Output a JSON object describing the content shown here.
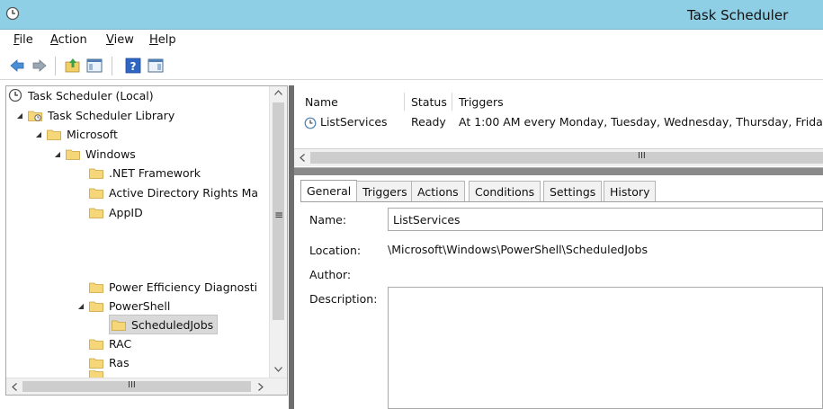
{
  "window": {
    "title": "Task Scheduler"
  },
  "menubar": {
    "items": [
      "File",
      "Action",
      "View",
      "Help"
    ]
  },
  "toolbar": {
    "buttons": [
      "back-arrow-icon",
      "forward-arrow-icon",
      "folder-up-icon",
      "console-tree-icon",
      "help-icon",
      "action-pane-icon"
    ]
  },
  "tree": {
    "items": [
      {
        "label": "Task Scheduler (Local)",
        "icon": "clock-icon"
      },
      {
        "label": "Task Scheduler Library",
        "icon": "library-folder-icon",
        "arrow": "◢"
      },
      {
        "label": "Microsoft",
        "icon": "folder-icon",
        "arrow": "◢"
      },
      {
        "label": "Windows",
        "icon": "folder-icon",
        "arrow": "◢"
      },
      {
        "label": ".NET Framework",
        "icon": "folder-icon"
      },
      {
        "label": "Active Directory Rights Ma",
        "icon": "folder-icon"
      },
      {
        "label": "AppID",
        "icon": "folder-icon"
      },
      {
        "label": "Power Efficiency Diagnosti",
        "icon": "folder-icon"
      },
      {
        "label": "PowerShell",
        "icon": "folder-icon",
        "arrow": "◢"
      },
      {
        "label": "ScheduledJobs",
        "icon": "folder-icon",
        "selected": true
      },
      {
        "label": "RAC",
        "icon": "folder-icon"
      },
      {
        "label": "Ras",
        "icon": "folder-icon"
      }
    ],
    "scroll_grip": "≡",
    "hscroll_thumb": "III"
  },
  "tasklist": {
    "columns": [
      "Name",
      "Status",
      "Triggers"
    ],
    "rows": [
      {
        "name": "ListServices",
        "status": "Ready",
        "triggers": "At 1:00 AM every Monday, Tuesday, Wednesday, Thursday, Frida"
      }
    ],
    "hscroll_thumb": "III"
  },
  "details": {
    "tabs": [
      "General",
      "Triggers",
      "Actions",
      "Conditions",
      "Settings",
      "History"
    ],
    "active_tab": "General",
    "fields": {
      "name_label": "Name:",
      "name_value": "ListServices",
      "location_label": "Location:",
      "location_value": "\\Microsoft\\Windows\\PowerShell\\ScheduledJobs",
      "author_label": "Author:",
      "description_label": "Description:"
    }
  },
  "colors": {
    "titlebar": "#8fcfe6",
    "folder": "#f5d77a",
    "selection": "#d9d9d9"
  }
}
